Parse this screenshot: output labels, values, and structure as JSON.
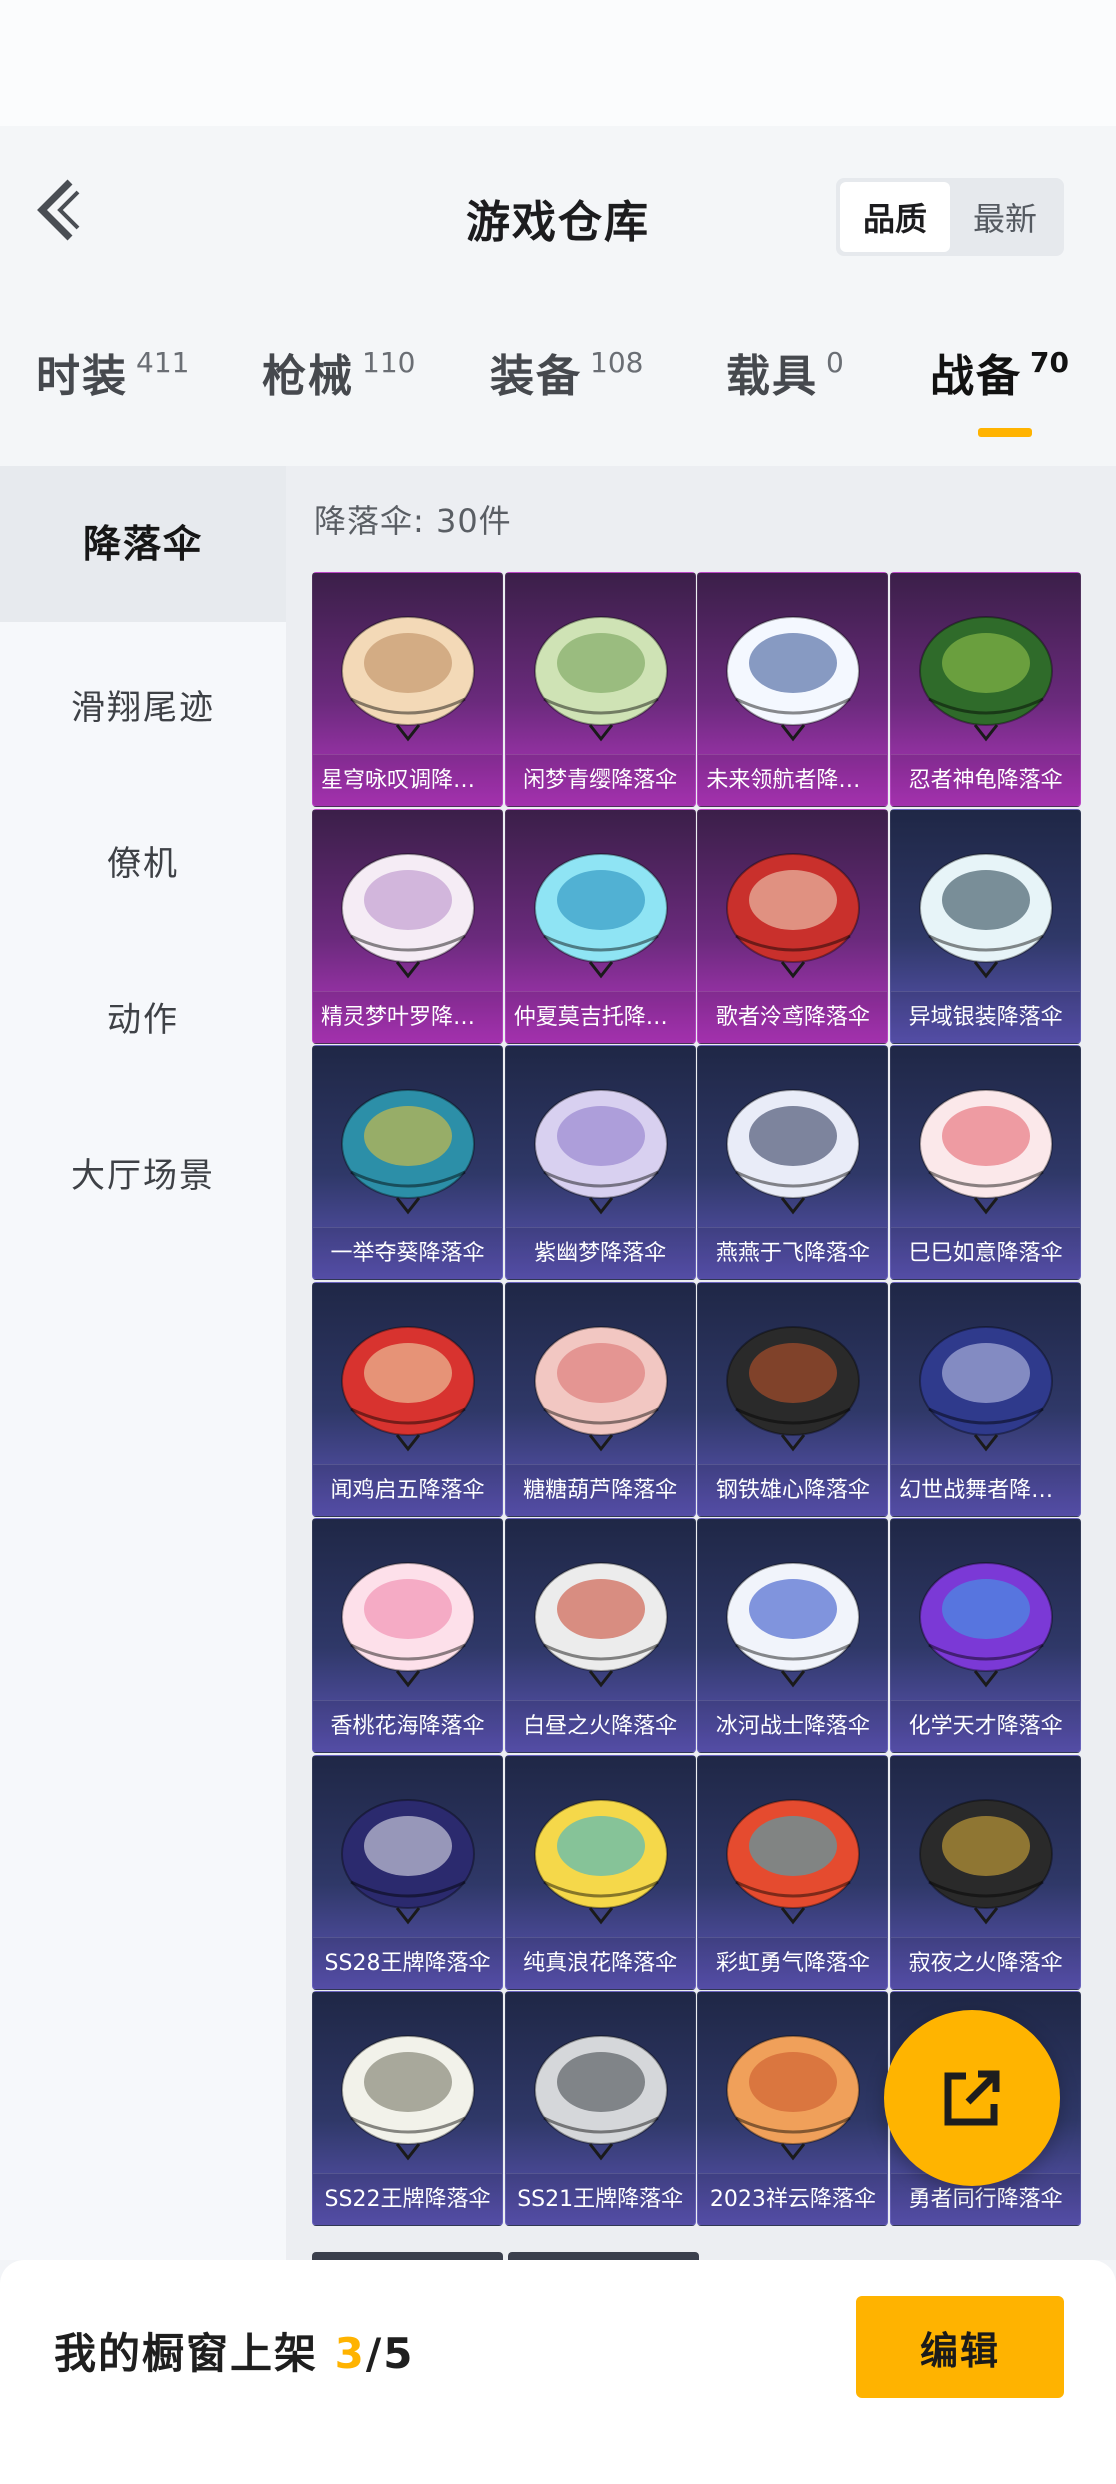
{
  "header": {
    "title": "游戏仓库"
  },
  "sort": {
    "options": [
      "品质",
      "最新"
    ],
    "selected": "品质"
  },
  "categories": [
    {
      "label": "时装",
      "count": "411"
    },
    {
      "label": "枪械",
      "count": "110"
    },
    {
      "label": "装备",
      "count": "108"
    },
    {
      "label": "载具",
      "count": "0"
    },
    {
      "label": "战备",
      "count": "70"
    }
  ],
  "active_category": "战备",
  "sidebar": {
    "items": [
      "降落伞",
      "滑翔尾迹",
      "僚机",
      "动作",
      "大厅场景"
    ],
    "active": "降落伞"
  },
  "content": {
    "count_label": "降落伞: 30件",
    "items": [
      {
        "name": "星穹咏叹调降落伞",
        "rarity": "purple"
      },
      {
        "name": "闲梦青缨降落伞",
        "rarity": "purple"
      },
      {
        "name": "未来领航者降落伞",
        "rarity": "purple"
      },
      {
        "name": "忍者神龟降落伞",
        "rarity": "purple"
      },
      {
        "name": "精灵梦叶罗降落伞",
        "rarity": "purple"
      },
      {
        "name": "仲夏莫吉托降落伞",
        "rarity": "purple"
      },
      {
        "name": "歌者泠鸢降落伞",
        "rarity": "purple"
      },
      {
        "name": "异域银装降落伞",
        "rarity": "blue"
      },
      {
        "name": "一举夺葵降落伞",
        "rarity": "blue"
      },
      {
        "name": "紫幽梦降落伞",
        "rarity": "blue"
      },
      {
        "name": "燕燕于飞降落伞",
        "rarity": "blue"
      },
      {
        "name": "巳巳如意降落伞",
        "rarity": "blue"
      },
      {
        "name": "闻鸡启五降落伞",
        "rarity": "blue"
      },
      {
        "name": "糖糖葫芦降落伞",
        "rarity": "blue"
      },
      {
        "name": "钢铁雄心降落伞",
        "rarity": "blue"
      },
      {
        "name": "幻世战舞者降落伞",
        "rarity": "blue"
      },
      {
        "name": "香桃花海降落伞",
        "rarity": "blue"
      },
      {
        "name": "白昼之火降落伞",
        "rarity": "blue"
      },
      {
        "name": "冰河战士降落伞",
        "rarity": "blue"
      },
      {
        "name": "化学天才降落伞",
        "rarity": "blue"
      },
      {
        "name": "SS28王牌降落伞",
        "rarity": "blue"
      },
      {
        "name": "纯真浪花降落伞",
        "rarity": "blue"
      },
      {
        "name": "彩虹勇气降落伞",
        "rarity": "blue"
      },
      {
        "name": "寂夜之火降落伞",
        "rarity": "blue"
      },
      {
        "name": "SS22王牌降落伞",
        "rarity": "blue"
      },
      {
        "name": "SS21王牌降落伞",
        "rarity": "blue"
      },
      {
        "name": "2023祥云降落伞",
        "rarity": "blue"
      },
      {
        "name": "勇者同行降落伞",
        "rarity": "blue"
      }
    ]
  },
  "bottom": {
    "showcase_prefix": "我的橱窗上架 ",
    "showcase_current": "3",
    "showcase_total": "/5",
    "edit_label": "编辑"
  },
  "colors": {
    "accent": "#ffb300",
    "purple_card": "#8a2d9c",
    "blue_card": "#3a3f7a"
  },
  "icons": {
    "back": "chevron-left-icon",
    "share": "share-external-icon"
  }
}
